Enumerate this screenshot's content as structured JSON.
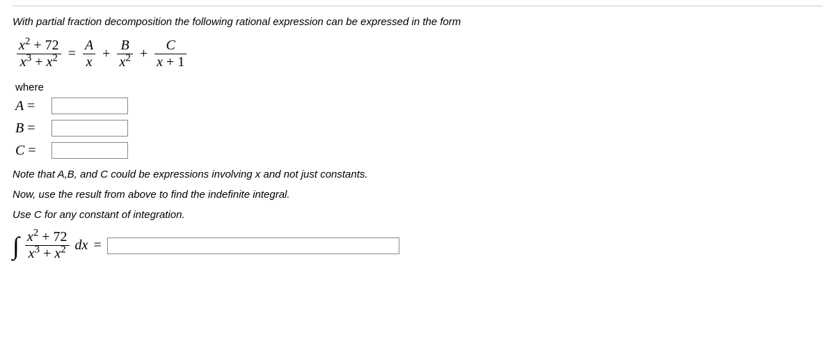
{
  "intro": "With partial fraction decomposition the following rational expression can be expressed in the form",
  "frac_main": {
    "num": "x² + 72",
    "den": "x³ + x²"
  },
  "eq": "=",
  "plus": "+",
  "termA": {
    "num": "A",
    "den": "x"
  },
  "termB": {
    "num": "B",
    "den": "x²"
  },
  "termC": {
    "num": "C",
    "den": "x + 1"
  },
  "where": "where",
  "labels": {
    "A": "A =",
    "B": "B =",
    "C": "C ="
  },
  "values": {
    "A": "",
    "B": "",
    "C": "",
    "integral": ""
  },
  "note": "Note that A,B, and C could be expressions involving x and not just constants.",
  "now": "Now, use the result from above to find the indefinite integral.",
  "usec": "Use C for any constant of integration.",
  "intfrac": {
    "num": "x² + 72",
    "den": "x³ + x²"
  },
  "dx": "dx",
  "inteq": "="
}
